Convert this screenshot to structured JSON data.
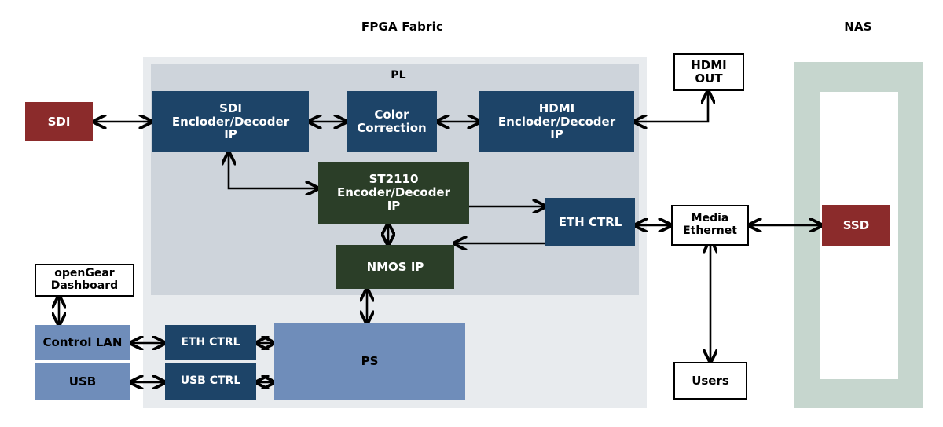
{
  "diagram": {
    "title_fpga": "FPGA Fabric",
    "title_nas": "NAS",
    "pl_label": "PL"
  },
  "colors": {
    "navy": "#1d4468",
    "green": "#2b3e28",
    "red": "#8b2b2b",
    "steel": "#6f8dba",
    "fabric_bg": "#e8ebee",
    "pl_bg": "#ced4db",
    "nas_frame": "#c6d6ce",
    "white": "#ffffff",
    "line": "#000000"
  },
  "blocks": {
    "sdi_external": "SDI",
    "sdi_codec": "SDI\nEncloder/Decoder\nIP",
    "color_correction": "Color\nCorrection",
    "hdmi_codec": "HDMI\nEncloder/Decoder\nIP",
    "hdmi_out": "HDMI\nOUT",
    "st2110": "ST2110\nEncoder/Decoder\nIP",
    "nmos": "NMOS IP",
    "eth_ctrl_media": "ETH CTRL",
    "media_ethernet": "Media\nEthernet",
    "users": "Users",
    "ssd": "SSD",
    "opengear": "openGear\nDashboard",
    "control_lan": "Control LAN",
    "usb": "USB",
    "eth_ctrl_ps": "ETH CTRL",
    "usb_ctrl": "USB CTRL",
    "ps": "PS"
  },
  "connections": [
    {
      "name": "sdi-external-to-sdi-codec",
      "from": "SDI",
      "to": "SDI Encloder/Decoder IP",
      "arrow": "bidirectional"
    },
    {
      "name": "sdi-codec-to-color-correction",
      "from": "SDI Encloder/Decoder IP",
      "to": "Color Correction",
      "arrow": "bidirectional"
    },
    {
      "name": "color-correction-to-hdmi-codec",
      "from": "Color Correction",
      "to": "HDMI Encloder/Decoder IP",
      "arrow": "bidirectional"
    },
    {
      "name": "hdmi-out-to-hdmi-codec",
      "from": "HDMI OUT",
      "to": "HDMI Encloder/Decoder IP",
      "arrow": "unidirectional"
    },
    {
      "name": "st2110-to-sdi-codec",
      "from": "ST2110 Encoder/Decoder IP",
      "to": "SDI Encloder/Decoder IP",
      "arrow": "bidirectional"
    },
    {
      "name": "st2110-to-eth-ctrl",
      "from": "ST2110 Encoder/Decoder IP",
      "to": "ETH CTRL",
      "arrow": "unidirectional"
    },
    {
      "name": "st2110-to-nmos",
      "from": "ST2110 Encoder/Decoder IP",
      "to": "NMOS IP",
      "arrow": "bidirectional"
    },
    {
      "name": "eth-ctrl-to-nmos",
      "from": "ETH CTRL",
      "to": "NMOS IP",
      "arrow": "unidirectional"
    },
    {
      "name": "eth-ctrl-to-media-ethernet",
      "from": "ETH CTRL",
      "to": "Media Ethernet",
      "arrow": "bidirectional"
    },
    {
      "name": "media-ethernet-to-ssd",
      "from": "Media Ethernet",
      "to": "SSD",
      "arrow": "bidirectional"
    },
    {
      "name": "media-ethernet-to-users",
      "from": "Media Ethernet",
      "to": "Users",
      "arrow": "bidirectional"
    },
    {
      "name": "opengear-to-control-lan",
      "from": "openGear Dashboard",
      "to": "Control LAN",
      "arrow": "bidirectional"
    },
    {
      "name": "control-lan-to-eth-ctrl-ps",
      "from": "Control LAN",
      "to": "ETH CTRL",
      "arrow": "bidirectional"
    },
    {
      "name": "usb-to-usb-ctrl",
      "from": "USB",
      "to": "USB CTRL",
      "arrow": "bidirectional"
    },
    {
      "name": "eth-ctrl-ps-to-ps",
      "from": "ETH CTRL",
      "to": "PS",
      "arrow": "bidirectional"
    },
    {
      "name": "usb-ctrl-to-ps",
      "from": "USB CTRL",
      "to": "PS",
      "arrow": "bidirectional"
    },
    {
      "name": "nmos-to-ps",
      "from": "NMOS IP",
      "to": "PS",
      "arrow": "bidirectional"
    }
  ]
}
